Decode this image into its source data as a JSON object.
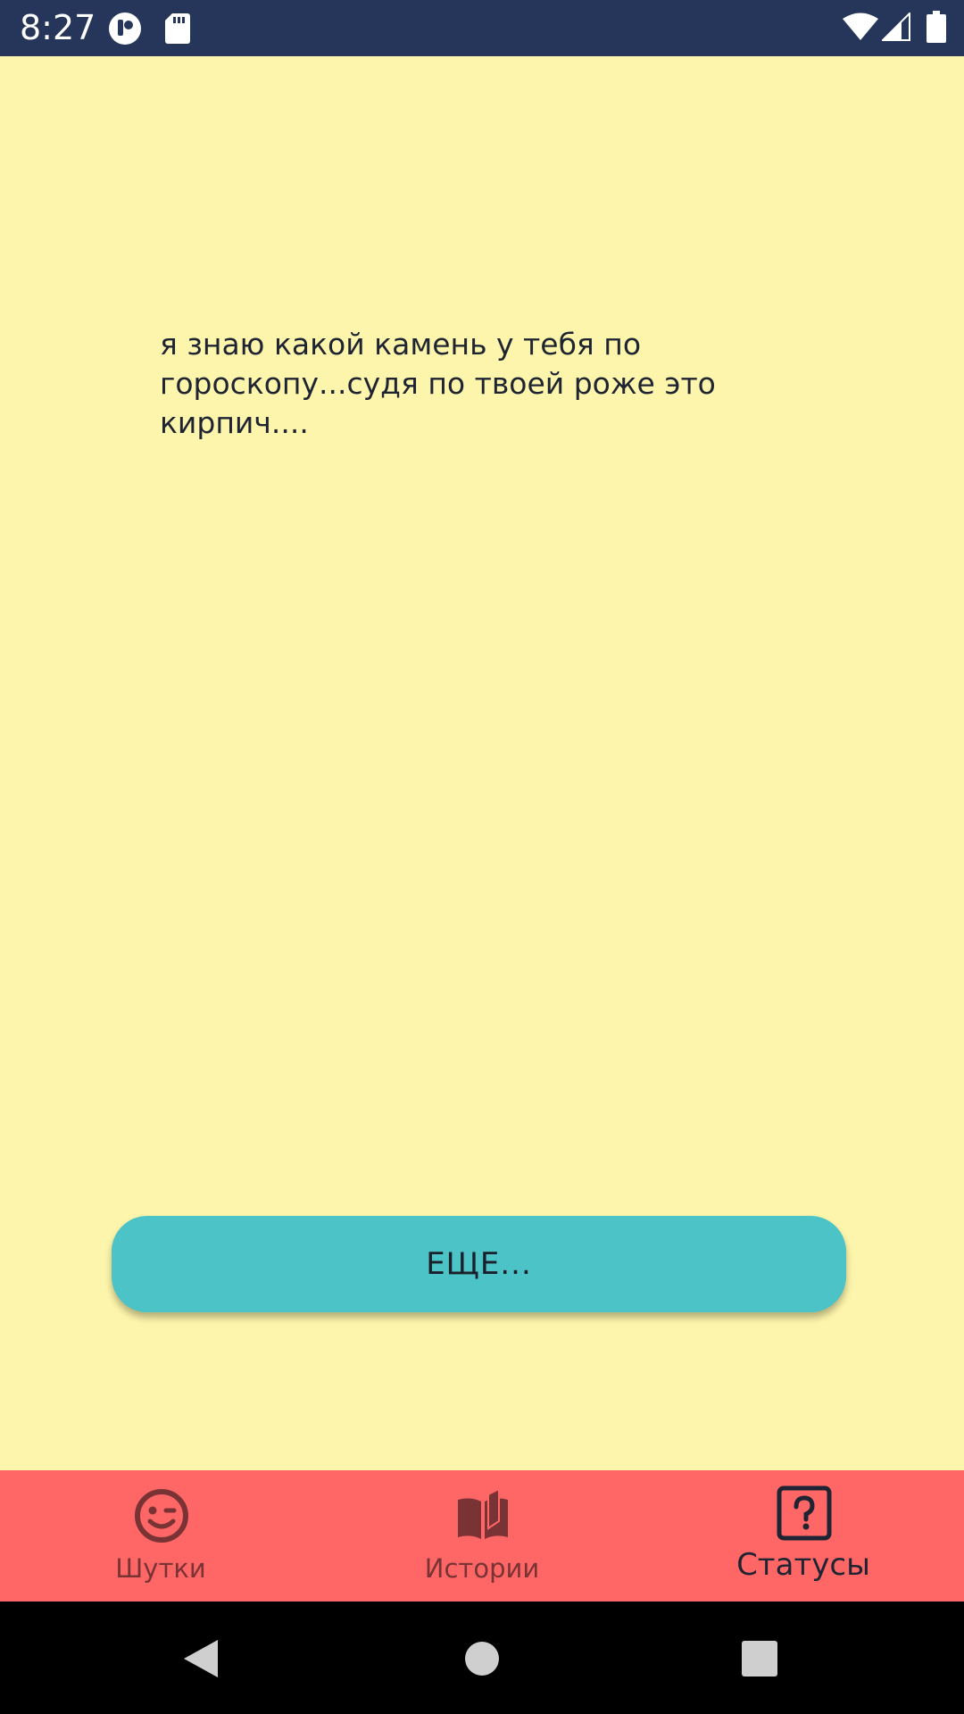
{
  "status_bar": {
    "time": "8:27",
    "background_color": "#26365a",
    "icons": [
      "app-notification-icon",
      "sd-card-icon",
      "wifi-icon",
      "cellular-signal-icon",
      "battery-icon"
    ]
  },
  "content": {
    "background_color": "#fdf5ab",
    "quote": "я знаю какой камень у тебя по\nгороскопу...судя по твоей роже это\nкирпич...."
  },
  "more_button": {
    "label": "ЕЩЕ...",
    "color": "#4bc3c7"
  },
  "bottom_nav": {
    "background_color": "#ff6666",
    "active_color": "#1f2433",
    "inactive_color": "#7a3334",
    "items": [
      {
        "label": "Шутки",
        "icon": "winking-smiley-icon",
        "active": false
      },
      {
        "label": "Истории",
        "icon": "open-book-icon",
        "active": false
      },
      {
        "label": "Статусы",
        "icon": "question-box-icon",
        "active": true
      }
    ]
  },
  "system_nav": {
    "buttons": [
      "back-icon",
      "home-icon",
      "recents-icon"
    ]
  }
}
